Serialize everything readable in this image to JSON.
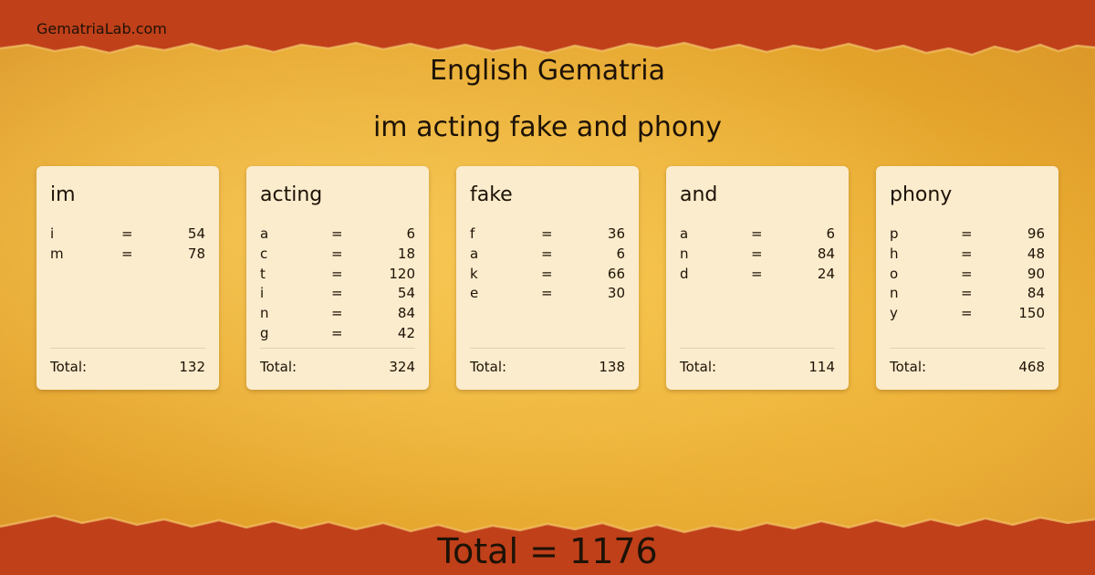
{
  "site": {
    "name": "GematriaLab.com"
  },
  "header": {
    "title": "English Gematria",
    "phrase": "im acting fake and phony"
  },
  "labels": {
    "eq": "=",
    "total": "Total:"
  },
  "cards": [
    {
      "word": "im",
      "letters": [
        {
          "l": "i",
          "v": "54"
        },
        {
          "l": "m",
          "v": "78"
        }
      ],
      "total": "132"
    },
    {
      "word": "acting",
      "letters": [
        {
          "l": "a",
          "v": "6"
        },
        {
          "l": "c",
          "v": "18"
        },
        {
          "l": "t",
          "v": "120"
        },
        {
          "l": "i",
          "v": "54"
        },
        {
          "l": "n",
          "v": "84"
        },
        {
          "l": "g",
          "v": "42"
        }
      ],
      "total": "324"
    },
    {
      "word": "fake",
      "letters": [
        {
          "l": "f",
          "v": "36"
        },
        {
          "l": "a",
          "v": "6"
        },
        {
          "l": "k",
          "v": "66"
        },
        {
          "l": "e",
          "v": "30"
        }
      ],
      "total": "138"
    },
    {
      "word": "and",
      "letters": [
        {
          "l": "a",
          "v": "6"
        },
        {
          "l": "n",
          "v": "84"
        },
        {
          "l": "d",
          "v": "24"
        }
      ],
      "total": "114"
    },
    {
      "word": "phony",
      "letters": [
        {
          "l": "p",
          "v": "96"
        },
        {
          "l": "h",
          "v": "48"
        },
        {
          "l": "o",
          "v": "90"
        },
        {
          "l": "n",
          "v": "84"
        },
        {
          "l": "y",
          "v": "150"
        }
      ],
      "total": "468"
    }
  ],
  "footer": {
    "grand_total": "Total = 1176"
  },
  "colors": {
    "torn_red": "#c0401a",
    "paper": "#e5a629",
    "card": "#fbeccd",
    "text": "#1d1206"
  }
}
